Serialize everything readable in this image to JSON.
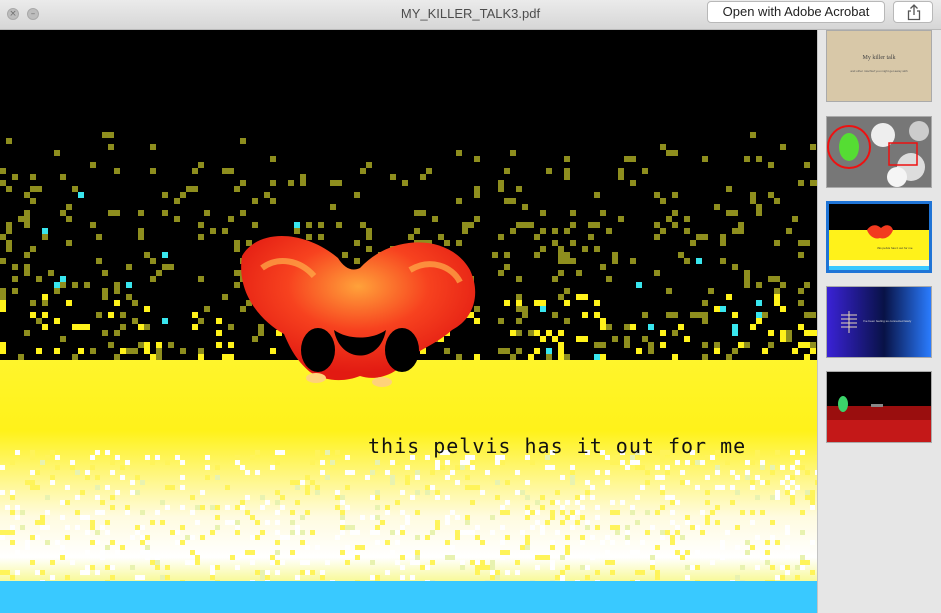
{
  "window": {
    "title": "MY_KILLER_TALK3.pdf",
    "open_button_label": "Open with Adobe Acrobat"
  },
  "slide": {
    "caption": "this pelvis has it out for me"
  },
  "thumbnails": [
    {
      "title": "My killer talk",
      "subtitle": "and other mischief you might get away with"
    },
    {},
    {
      "caption": "this pelvis has it out for me"
    },
    {
      "caption": "I've been feeling so connected lately"
    },
    {}
  ],
  "colors": {
    "selection": "#1f74d6",
    "pelvis": "#f23a1f",
    "sand": "#fff21a",
    "water": "#39c9ff"
  }
}
